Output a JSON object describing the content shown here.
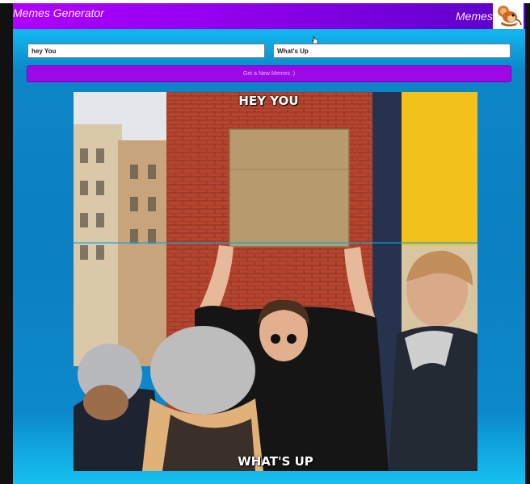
{
  "header": {
    "title": "Memes Generator",
    "right_label": "Memes",
    "logo_icon": "jerry-mouse-logo"
  },
  "form": {
    "top_text_value": "hey You",
    "bottom_text_value": "What's Up",
    "generate_label": "Get a New Memes :)"
  },
  "meme": {
    "top_caption": "HEY YOU",
    "bottom_caption": "WHAT'S UP"
  },
  "colors": {
    "header_gradient_start": "#b000ff",
    "header_gradient_end": "#5a00c8",
    "background": "#0b7fc0",
    "button": "#9c08e6"
  }
}
